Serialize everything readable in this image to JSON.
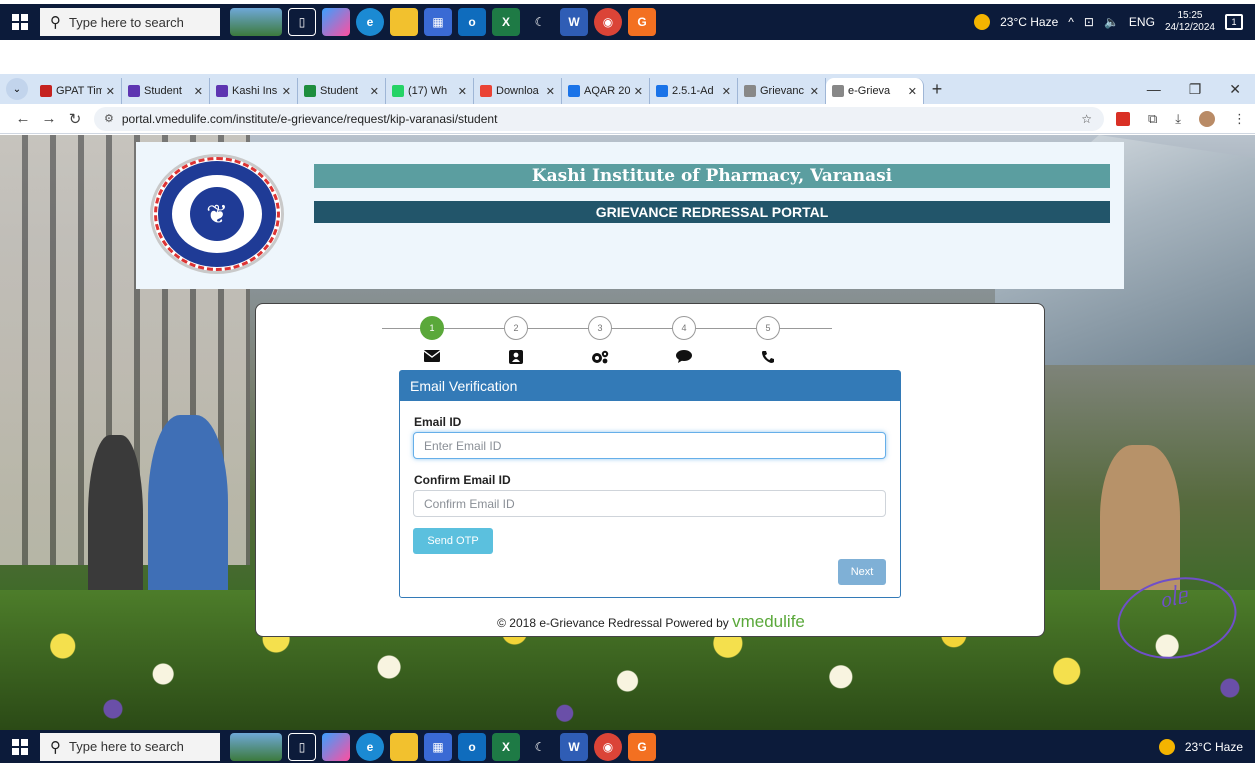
{
  "taskbar": {
    "search_placeholder": "Type here to search",
    "weather": "23°C  Haze",
    "lang": "ENG",
    "time": "15:25",
    "date": "24/12/2024",
    "notif_count": "1"
  },
  "browser": {
    "tabs": [
      {
        "title": "GPAT Tim",
        "color": "#c5221f"
      },
      {
        "title": "Student",
        "color": "#5e35b1"
      },
      {
        "title": "Kashi Ins",
        "color": "#5e35b1"
      },
      {
        "title": "Student",
        "color": "#1e8e3e"
      },
      {
        "title": "(17) Wh",
        "color": "#25d366"
      },
      {
        "title": "Downloa",
        "color": "#ea4335"
      },
      {
        "title": "AQAR 20",
        "color": "#1a73e8"
      },
      {
        "title": "2.5.1-Ad",
        "color": "#1a73e8"
      },
      {
        "title": "Grievanc",
        "color": "#888888"
      },
      {
        "title": "e-Grieva",
        "color": "#888888"
      }
    ],
    "url": "portal.vmedulife.com/institute/e-grievance/request/kip-varanasi/student"
  },
  "header": {
    "institute": "Kashi Institute of Pharmacy, Varanasi",
    "portal": "GRIEVANCE REDRESSAL PORTAL"
  },
  "steps": [
    {
      "number": "1",
      "icon": "envelope-icon",
      "active": true
    },
    {
      "number": "2",
      "icon": "contact-card-icon",
      "active": false
    },
    {
      "number": "3",
      "icon": "gears-icon",
      "active": false
    },
    {
      "number": "4",
      "icon": "chat-bubble-icon",
      "active": false
    },
    {
      "number": "5",
      "icon": "phone-icon",
      "active": false
    }
  ],
  "form": {
    "heading": "Email Verification",
    "email_label": "Email ID",
    "email_placeholder": "Enter Email ID",
    "confirm_label": "Confirm Email ID",
    "confirm_placeholder": "Confirm Email ID",
    "otp_button": "Send OTP",
    "next_button": "Next"
  },
  "footer": {
    "text": "© 2018 e-Grievance Redressal Powered by",
    "brand": "vmedulife"
  },
  "colors": {
    "panel_header": "#337ab7",
    "title_bar": "#5b9ea0",
    "subtitle_bar": "#22556a",
    "active_step": "#5aa83a"
  }
}
